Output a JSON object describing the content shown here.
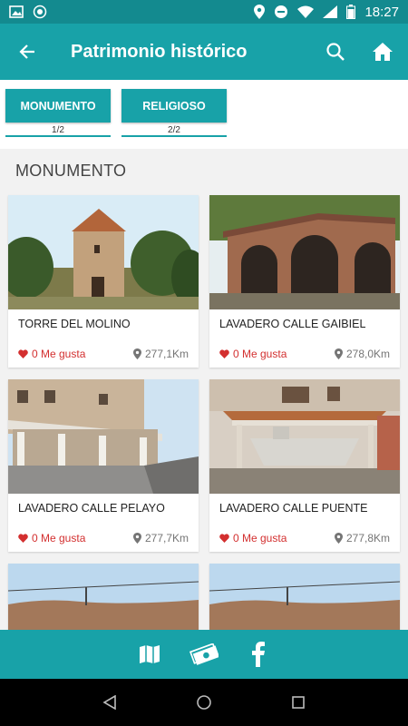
{
  "status_bar": {
    "time": "18:27"
  },
  "app_bar": {
    "title": "Patrimonio histórico"
  },
  "tabs": [
    {
      "label": "MONUMENTO",
      "count": "1/2"
    },
    {
      "label": "RELIGIOSO",
      "count": "2/2"
    }
  ],
  "section": {
    "title": "MONUMENTO"
  },
  "cards": [
    {
      "name": "TORRE DEL MOLINO",
      "likes": "0 Me gusta",
      "distance": "277,1Km"
    },
    {
      "name": "LAVADERO CALLE GAIBIEL",
      "likes": "0 Me gusta",
      "distance": "278,0Km"
    },
    {
      "name": "LAVADERO CALLE PELAYO",
      "likes": "0 Me gusta",
      "distance": "277,7Km"
    },
    {
      "name": "LAVADERO CALLE PUENTE",
      "likes": "0 Me gusta",
      "distance": "277,8Km"
    },
    {
      "name": "",
      "likes": "",
      "distance": ""
    },
    {
      "name": "",
      "likes": "",
      "distance": ""
    }
  ],
  "colors": {
    "primary": "#18a2a8",
    "primary_dark": "#138a8f",
    "like": "#d32f2f"
  },
  "icons": [
    "back-arrow-icon",
    "search-icon",
    "home-icon",
    "map-icon",
    "money-icon",
    "facebook-icon"
  ]
}
